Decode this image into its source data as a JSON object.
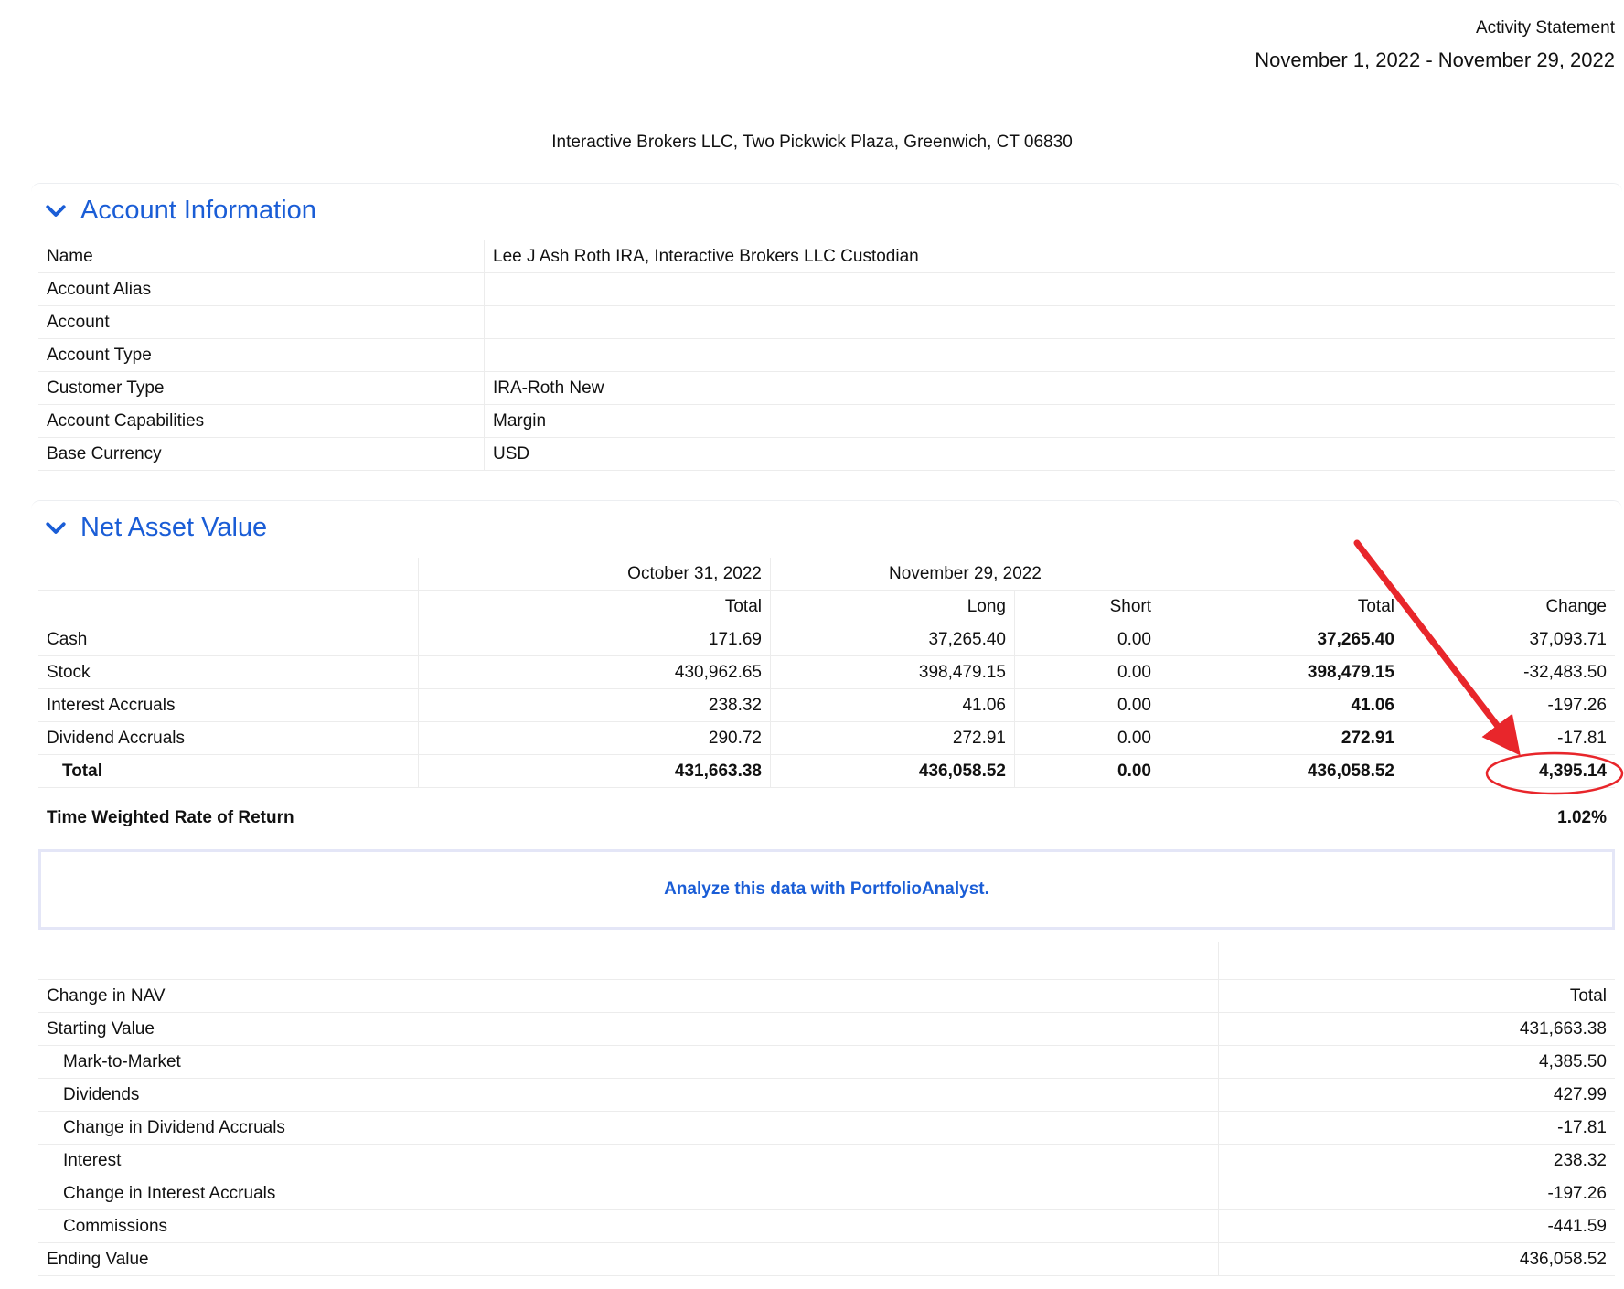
{
  "header": {
    "title": "Activity Statement",
    "period": "November 1, 2022 - November 29, 2022",
    "broker": "Interactive Brokers LLC, Two Pickwick Plaza, Greenwich, CT 06830"
  },
  "account_information": {
    "title": "Account Information",
    "rows": [
      {
        "label": "Name",
        "value": "Lee J Ash Roth IRA, Interactive Brokers LLC Custodian"
      },
      {
        "label": "Account Alias",
        "value": ""
      },
      {
        "label": "Account",
        "value": ""
      },
      {
        "label": "Account Type",
        "value": ""
      },
      {
        "label": "Customer Type",
        "value": "IRA-Roth New"
      },
      {
        "label": "Account Capabilities",
        "value": "Margin"
      },
      {
        "label": "Base Currency",
        "value": "USD"
      }
    ]
  },
  "net_asset_value": {
    "title": "Net Asset Value",
    "period_headers": [
      "October 31, 2022",
      "November 29, 2022"
    ],
    "column_headers": [
      "Total",
      "Long",
      "Short",
      "Total",
      "Change"
    ],
    "rows": [
      {
        "label": "Cash",
        "values": [
          "171.69",
          "37,265.40",
          "0.00",
          "37,265.40",
          "37,093.71"
        ]
      },
      {
        "label": "Stock",
        "values": [
          "430,962.65",
          "398,479.15",
          "0.00",
          "398,479.15",
          "-32,483.50"
        ]
      },
      {
        "label": "Interest Accruals",
        "values": [
          "238.32",
          "41.06",
          "0.00",
          "41.06",
          "-197.26"
        ]
      },
      {
        "label": "Dividend Accruals",
        "values": [
          "290.72",
          "272.91",
          "0.00",
          "272.91",
          "-17.81"
        ]
      }
    ],
    "total": {
      "label": "Total",
      "values": [
        "431,663.38",
        "436,058.52",
        "0.00",
        "436,058.52",
        "4,395.14"
      ]
    },
    "twrr": {
      "label": "Time Weighted Rate of Return",
      "value": "1.02%"
    },
    "portfolio_analyst_link": "Analyze this data with PortfolioAnalyst."
  },
  "change_in_nav": {
    "header": {
      "label": "Change in NAV",
      "value": "Total"
    },
    "rows": [
      {
        "label": "Starting Value",
        "value": "431,663.38"
      },
      {
        "label": "Mark-to-Market",
        "value": "4,385.50"
      },
      {
        "label": "Dividends",
        "value": "427.99"
      },
      {
        "label": "Change in Dividend Accruals",
        "value": "-17.81"
      },
      {
        "label": "Interest",
        "value": "238.32"
      },
      {
        "label": "Change in Interest Accruals",
        "value": "-197.26"
      },
      {
        "label": "Commissions",
        "value": "-441.59"
      },
      {
        "label": "Ending Value",
        "value": "436,058.52"
      }
    ]
  },
  "colors": {
    "accent": "#1a5dd6",
    "annotation": "#e8262b"
  },
  "icons": {
    "section_toggle": "chevron-down-icon"
  }
}
